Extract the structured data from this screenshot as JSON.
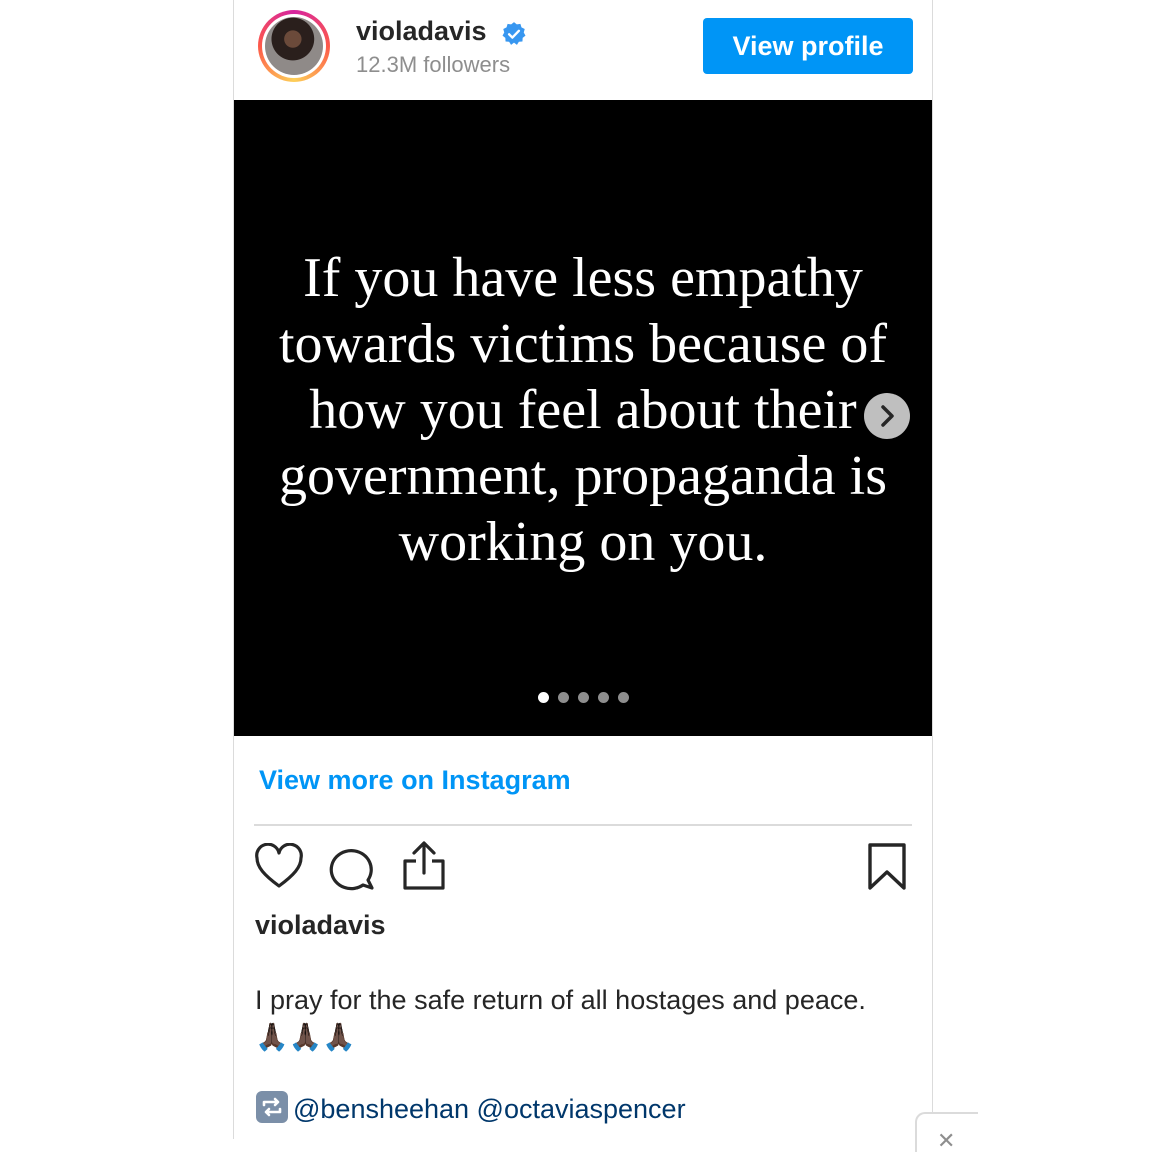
{
  "header": {
    "username": "violadavis",
    "followers": "12.3M followers",
    "view_profile_label": "View profile"
  },
  "post": {
    "quote_lines": [
      "If you have less empathy",
      "towards victims because of",
      "how you feel about their",
      "government, propaganda is",
      "working on you."
    ],
    "carousel": {
      "total_slides": 5,
      "active_slide": 1
    }
  },
  "view_more_label": "View more on Instagram",
  "actions": [
    "heart-icon",
    "comment-icon",
    "share-icon",
    "bookmark-icon"
  ],
  "caption": {
    "username": "violadavis",
    "text": "I pray for the safe return of all hostages and peace. 🙏🏿🙏🏿🙏🏿",
    "tags": "@bensheehan @octaviaspencer"
  },
  "colors": {
    "accent": "#0095f6",
    "text": "#262626",
    "muted": "#8e8e8e",
    "link": "#00376b",
    "media_bg": "#000000"
  }
}
